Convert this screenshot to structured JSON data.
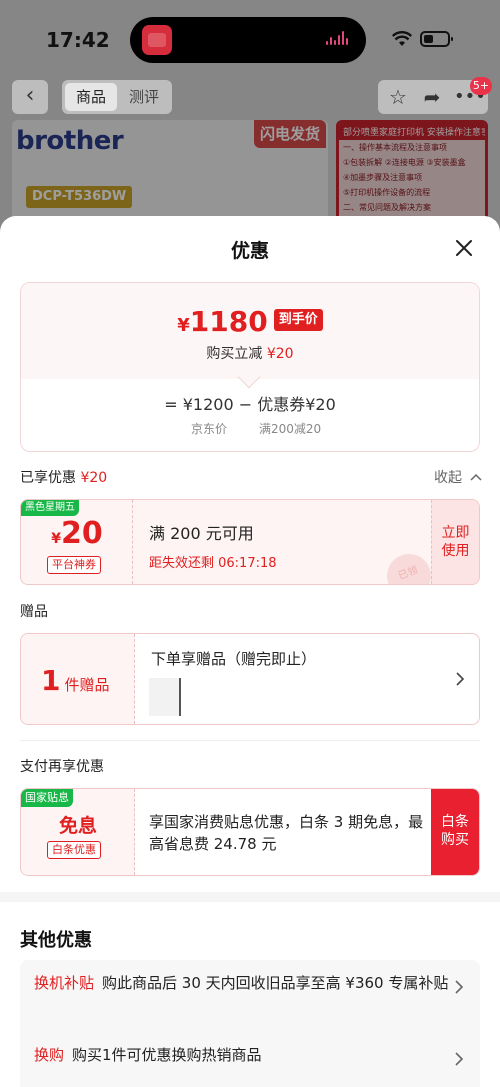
{
  "status_bar": {
    "time": "17:42"
  },
  "nav": {
    "back_label": "‹",
    "tabs": [
      {
        "label": "商品"
      },
      {
        "label": "测评"
      }
    ],
    "badge": "5+"
  },
  "product": {
    "brand": "brother",
    "model": "DCP-T536DW",
    "flash_label": "闪电发货",
    "guide": {
      "title": "部分喷墨家庭打印机 安装操作注意事项",
      "lines": [
        "一、操作基本流程及注意事项",
        "①包装拆解 ②连接电源 ③安装墨盒",
        "④加墨步骤及注意事项",
        "⑤打印机操作设备的流程",
        "二、常见问题及解决方案"
      ]
    }
  },
  "sheet": {
    "title": "优惠",
    "price_card": {
      "currency": "¥",
      "final_price": "1180",
      "final_tag": "到手价",
      "instant_prefix": "购买立减",
      "instant_amount": "¥20",
      "formula": "=  ¥1200  −  优惠券¥20",
      "jd_price_label": "京东价",
      "coupon_rule": "满200减20"
    },
    "enjoyed": {
      "label": "已享优惠",
      "amount": "¥20",
      "toggle": "收起"
    },
    "coupon": {
      "event_tag": "黑色星期五",
      "currency": "¥",
      "value": "20",
      "type": "平台神券",
      "condition": "满 200 元可用",
      "timer": "距失效还剩 06:17:18",
      "stamp": "已领",
      "button": "立即\n使用"
    },
    "gift_section": {
      "header": "赠品",
      "count": "1",
      "unit": "件赠品",
      "title": "下单享赠品（赠完即止）"
    },
    "pay_section": {
      "header": "支付再享优惠",
      "tag": "国家贴息",
      "free_label": "免息",
      "sub_tag": "白条优惠",
      "description": "享国家消费贴息优惠，白条 3 期免息，最高省息费 24.78 元",
      "button": "白条\n购买"
    },
    "other_offers": {
      "title": "其他优惠",
      "items": [
        {
          "tag": "换机补贴",
          "text": "购此商品后 30 天内回收旧品享至高 ¥360 专属补贴"
        },
        {
          "tag": "换购",
          "text": "购买1件可优惠换购热销商品"
        }
      ]
    }
  },
  "colors": {
    "accent_red": "#e02020",
    "green_tag": "#18b848"
  }
}
